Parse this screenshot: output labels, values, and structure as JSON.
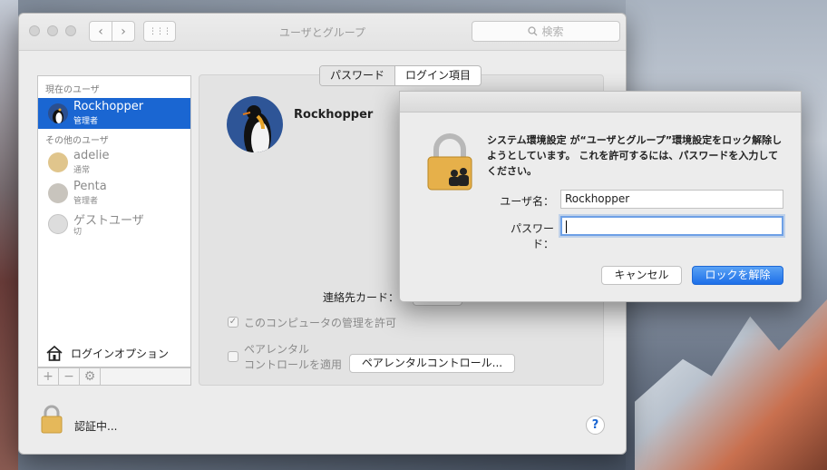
{
  "window": {
    "title": "ユーザとグループ",
    "search_placeholder": "検索",
    "nav_back": "‹",
    "nav_forward": "›",
    "grid_icon": "⋮⋮⋮"
  },
  "sidebar": {
    "current_header": "現在のユーザ",
    "current_user": {
      "name": "Rockhopper",
      "role": "管理者"
    },
    "others_header": "その他のユーザ",
    "others": [
      {
        "name": "adelie",
        "role": "通常"
      },
      {
        "name": "Penta",
        "role": "管理者"
      },
      {
        "name": "ゲストユーザ",
        "role": "切"
      }
    ],
    "login_options": "ログインオプション",
    "tools": {
      "add": "+",
      "remove": "−",
      "gear": "⚙"
    }
  },
  "tabs": {
    "password": "パスワード",
    "login_items": "ログイン項目"
  },
  "main": {
    "user_name": "Rockhopper",
    "contact_label": "連絡先カード：",
    "allow_admin": "このコンピュータの管理を許可",
    "parental_line1": "ペアレンタル",
    "parental_line2": "コントロールを適用",
    "parental_button": "ペアレンタルコントロール...",
    "auth_status": "認証中...",
    "help": "?"
  },
  "dialog": {
    "message": "システム環境設定 が“ユーザとグループ”環境設定をロック解除しようとしています。 これを許可するには、パスワードを入力してください。",
    "username_label": "ユーザ名：",
    "username_value": "Rockhopper",
    "password_label": "パスワード：",
    "password_value": "",
    "cancel": "キャンセル",
    "unlock": "ロックを解除",
    "accent_color": "#1d6fe8"
  }
}
